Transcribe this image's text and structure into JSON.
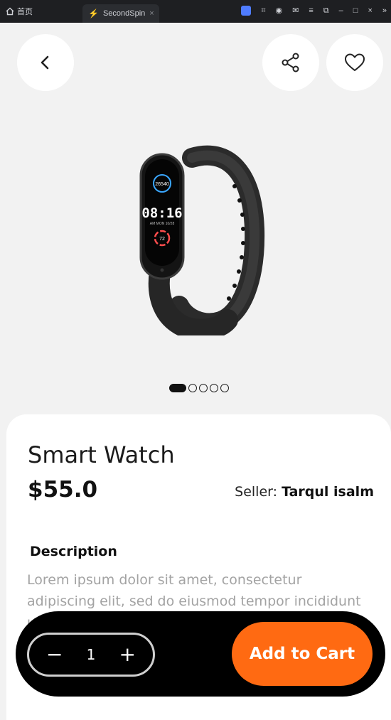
{
  "browser": {
    "home_label": "首页",
    "tab_title": "SecondSpin",
    "tab_close": "×",
    "window_controls": [
      "≡",
      "⧉",
      "–",
      "□",
      "×",
      "»"
    ]
  },
  "product": {
    "watch_steps": "26540",
    "watch_time": "08:16",
    "watch_date": "AM MON 10/28",
    "watch_heart": "72",
    "image_count": 5,
    "image_active_index": 0,
    "title": "Smart Watch",
    "price": "$55.0",
    "seller_label": "Seller: ",
    "seller_name": "Tarqul isalm",
    "description_title": "Description",
    "description_text": "Lorem ipsum dolor sit amet, consectetur adipiscing elit, sed do eiusmod tempor incididunt ut labore et dolore magna aliqua. Lorem"
  },
  "cart": {
    "minus": "−",
    "quantity": "1",
    "plus": "+",
    "add_label": "Add to Cart"
  },
  "colors": {
    "accent": "#ff6a12",
    "bar": "#000000"
  }
}
